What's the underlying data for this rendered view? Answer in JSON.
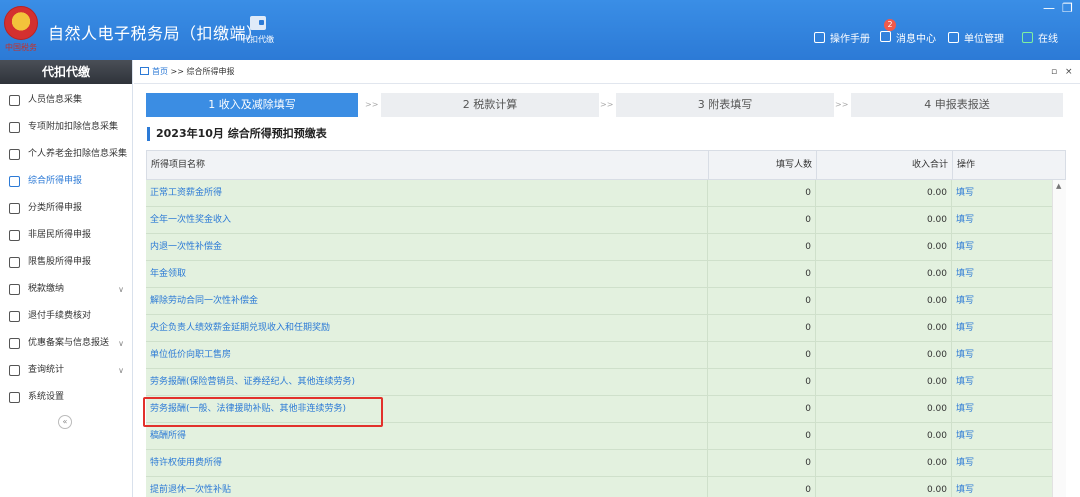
{
  "header": {
    "emblem_text": "中国税务",
    "app_title": "自然人电子税务局（扣缴端）",
    "module_label": "代扣代缴",
    "manual_label": "操作手册",
    "message_label": "消息中心",
    "message_count": "2",
    "unit_label": "单位管理",
    "online_label": "在线",
    "minimize": "—",
    "restore": "❐"
  },
  "sidebar": {
    "title": "代扣代缴",
    "items": [
      {
        "label": "人员信息采集"
      },
      {
        "label": "专项附加扣除信息采集"
      },
      {
        "label": "个人养老金扣除信息采集"
      },
      {
        "label": "综合所得申报"
      },
      {
        "label": "分类所得申报"
      },
      {
        "label": "非居民所得申报"
      },
      {
        "label": "限售股所得申报"
      },
      {
        "label": "税款缴纳"
      },
      {
        "label": "退付手续费核对"
      },
      {
        "label": "优惠备案与信息报送"
      },
      {
        "label": "查询统计"
      },
      {
        "label": "系统设置"
      }
    ],
    "collapse": "«"
  },
  "breadcrumb": {
    "home": "首页",
    "sep": ">>",
    "current": "综合所得申报"
  },
  "tab_controls": {
    "restore": "▫",
    "close": "×"
  },
  "steps": [
    {
      "label": "1 收入及减除填写"
    },
    {
      "label": "2 税款计算"
    },
    {
      "label": "3 附表填写"
    },
    {
      "label": "4 申报表报送"
    }
  ],
  "step_sep": ">>",
  "section_title": "2023年10月  综合所得预扣预缴表",
  "table": {
    "headers": {
      "name": "所得项目名称",
      "count": "填写人数",
      "income": "收入合计",
      "action": "操作"
    },
    "rows": [
      {
        "name": "正常工资薪金所得",
        "count": "0",
        "income": "0.00",
        "action": "填写"
      },
      {
        "name": "全年一次性奖金收入",
        "count": "0",
        "income": "0.00",
        "action": "填写"
      },
      {
        "name": "内退一次性补偿金",
        "count": "0",
        "income": "0.00",
        "action": "填写"
      },
      {
        "name": "年金领取",
        "count": "0",
        "income": "0.00",
        "action": "填写"
      },
      {
        "name": "解除劳动合同一次性补偿金",
        "count": "0",
        "income": "0.00",
        "action": "填写"
      },
      {
        "name": "央企负责人绩效薪金延期兑现收入和任期奖励",
        "count": "0",
        "income": "0.00",
        "action": "填写"
      },
      {
        "name": "单位低价向职工售房",
        "count": "0",
        "income": "0.00",
        "action": "填写"
      },
      {
        "name": "劳务报酬(保险营销员、证券经纪人、其他连续劳务)",
        "count": "0",
        "income": "0.00",
        "action": "填写"
      },
      {
        "name": "劳务报酬(一般、法律援助补贴、其他非连续劳务)",
        "count": "0",
        "income": "0.00",
        "action": "填写"
      },
      {
        "name": "稿酬所得",
        "count": "0",
        "income": "0.00",
        "action": "填写"
      },
      {
        "name": "特许权使用费所得",
        "count": "0",
        "income": "0.00",
        "action": "填写"
      },
      {
        "name": "提前退休一次性补贴",
        "count": "0",
        "income": "0.00",
        "action": "填写"
      }
    ]
  },
  "colors": {
    "header_blue": "#2c7ad6",
    "active_step": "#3b8de3",
    "row_green": "#e3f1df",
    "highlight_red": "#e2312b"
  }
}
